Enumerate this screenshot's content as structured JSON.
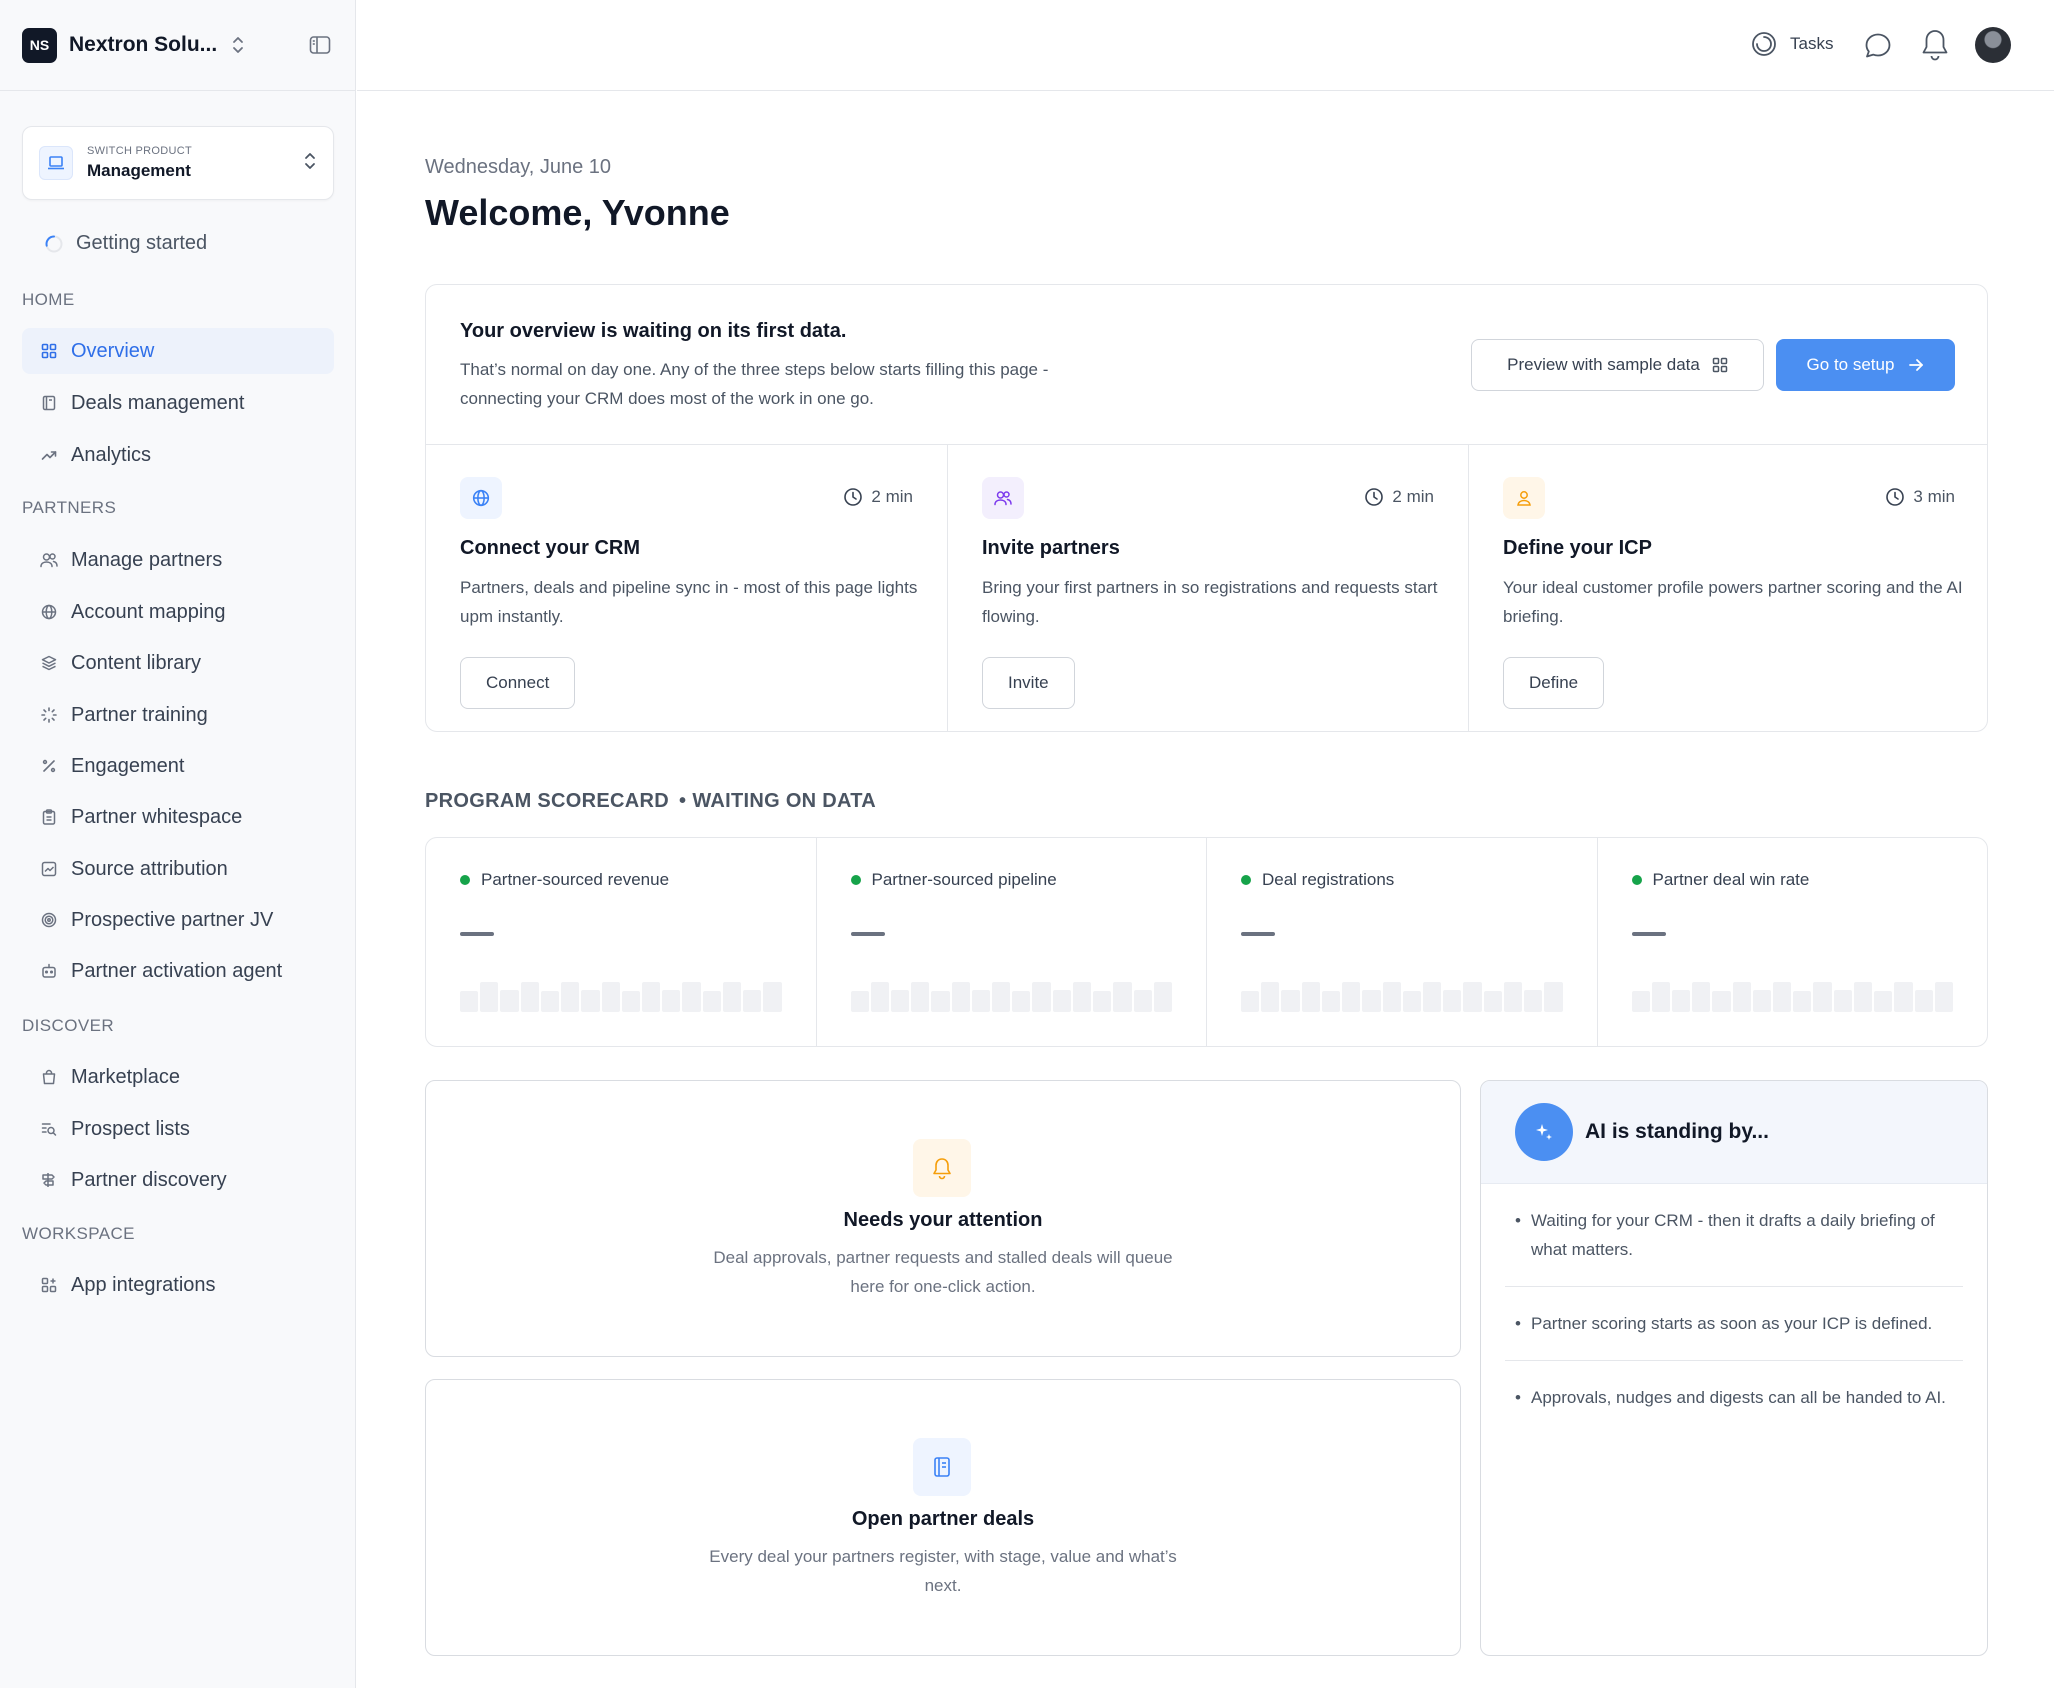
{
  "workspace": {
    "logo": "NS",
    "name": "Nextron Solu...",
    "switch_icon": "chevron-updown-icon",
    "collapse_icon": "sidebar-toggle-icon"
  },
  "product_switch": {
    "caption": "SWITCH PRODUCT",
    "value": "Management",
    "icon": "laptop-icon"
  },
  "getting_started": {
    "label": "Getting started",
    "icon": "progress-spinner-icon"
  },
  "sections": {
    "home": "HOME",
    "partners": "PARTNERS",
    "discover": "DISCOVER",
    "workspace": "WORKSPACE"
  },
  "nav": {
    "home": [
      {
        "label": "Overview",
        "icon": "grid-icon",
        "active": true
      },
      {
        "label": "Deals management",
        "icon": "book-icon"
      },
      {
        "label": "Analytics",
        "icon": "trend-icon"
      }
    ],
    "partners": [
      {
        "label": "Manage partners",
        "icon": "users-icon"
      },
      {
        "label": "Account mapping",
        "icon": "globe-icon"
      },
      {
        "label": "Content library",
        "icon": "layers-icon"
      },
      {
        "label": "Partner training",
        "icon": "loader-icon"
      },
      {
        "label": "Engagement",
        "icon": "percent-icon"
      },
      {
        "label": "Partner whitespace",
        "icon": "clipboard-icon"
      },
      {
        "label": "Source attribution",
        "icon": "chart-box-icon"
      },
      {
        "label": "Prospective partner JV",
        "icon": "target-icon"
      },
      {
        "label": "Partner activation agent",
        "icon": "robot-icon"
      }
    ],
    "discover": [
      {
        "label": "Marketplace",
        "icon": "bag-icon"
      },
      {
        "label": "Prospect lists",
        "icon": "list-search-icon"
      },
      {
        "label": "Partner discovery",
        "icon": "signpost-icon"
      }
    ],
    "workspace": [
      {
        "label": "App integrations",
        "icon": "apps-icon"
      }
    ]
  },
  "topbar": {
    "tasks_label": "Tasks"
  },
  "header": {
    "date": "Wednesday, June 10",
    "welcome": "Welcome, Yvonne"
  },
  "setup": {
    "title": "Your overview is waiting on its first data.",
    "desc": "That’s normal on day one. Any of the three steps below starts filling this page - connecting your CRM does most of the work in one go.",
    "preview_label": "Preview with sample data",
    "setup_label": "Go to setup",
    "steps": [
      {
        "title": "Connect your CRM",
        "time": "2 min",
        "desc": "Partners, deals and pipeline sync in - most of this page lights upm instantly.",
        "button": "Connect",
        "icon": "globe-icon",
        "color": "#3b82f6",
        "bg": "#eef4ff"
      },
      {
        "title": "Invite partners",
        "time": "2 min",
        "desc": "Bring your first partners in so registrations and requests start flowing.",
        "button": "Invite",
        "icon": "users-icon",
        "color": "#7c3aed",
        "bg": "#f3effd"
      },
      {
        "title": "Define your ICP",
        "time": "3 min",
        "desc": "Your ideal customer profile powers partner scoring and the AI briefing.",
        "button": "Define",
        "icon": "user-target-icon",
        "color": "#f59e0b",
        "bg": "#fff6e8"
      }
    ]
  },
  "scorecard": {
    "title": "PROGRAM SCORECARD",
    "status": "WAITING ON DATA",
    "metrics": [
      {
        "label": "Partner-sourced revenue",
        "value": "—"
      },
      {
        "label": "Partner-sourced pipeline",
        "value": "—"
      },
      {
        "label": "Deal registrations",
        "value": "—"
      },
      {
        "label": "Partner deal win rate",
        "value": "—"
      }
    ]
  },
  "attention": {
    "title": "Needs your attention",
    "desc": "Deal approvals, partner requests and stalled deals will queue here for one-click action.",
    "icon": "bell-icon"
  },
  "deals": {
    "title": "Open partner deals",
    "desc": "Every deal your partners register, with stage, value and what’s next.",
    "icon": "notebook-icon"
  },
  "ai": {
    "title": "AI is standing by...",
    "icon": "sparkle-icon",
    "items": [
      "Waiting for your CRM - then it drafts a daily briefing of what matters.",
      "Partner scoring starts as soon as your ICP is defined.",
      "Approvals, nudges and digests can all be handed to AI."
    ]
  }
}
